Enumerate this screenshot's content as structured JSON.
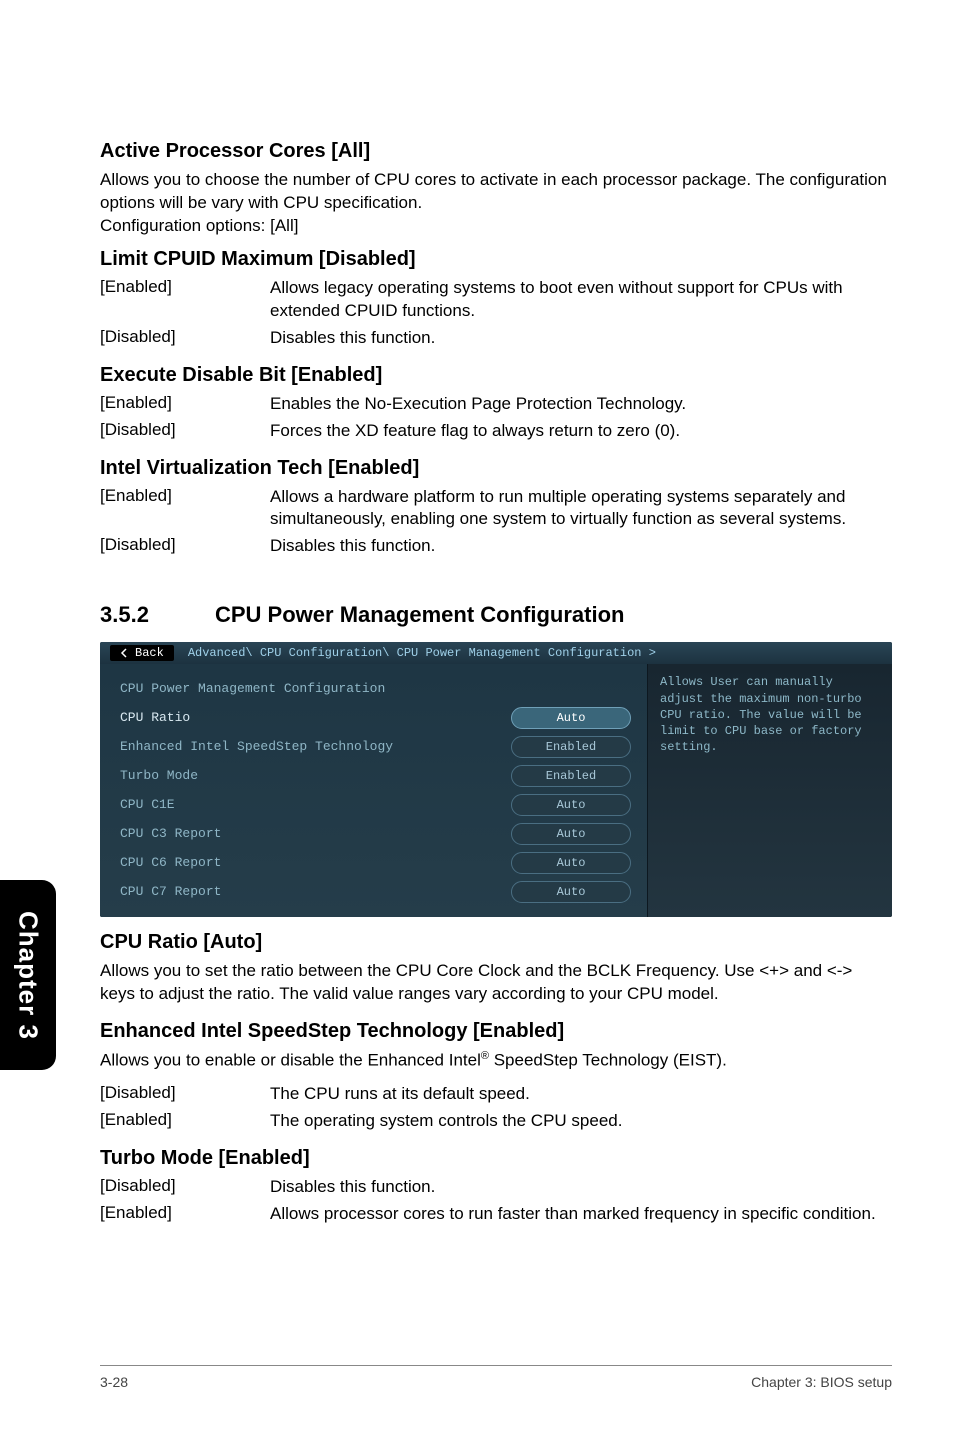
{
  "sidetab": "Chapter 3",
  "sections": {
    "apc": {
      "title": "Active Processor Cores [All]",
      "body": "Allows you to choose the number of CPU cores to activate in each processor package. The configuration options will be vary with CPU specification.",
      "body2": "Configuration options: [All]"
    },
    "lcm": {
      "title": "Limit CPUID Maximum [Disabled]",
      "rows": [
        {
          "k": "[Enabled]",
          "v": "Allows legacy operating systems to boot even without support for CPUs with extended CPUID functions."
        },
        {
          "k": "[Disabled]",
          "v": "Disables this function."
        }
      ]
    },
    "edb": {
      "title": "Execute Disable Bit [Enabled]",
      "rows": [
        {
          "k": "[Enabled]",
          "v": "Enables the No-Execution Page Protection Technology."
        },
        {
          "k": "[Disabled]",
          "v": "Forces the XD feature flag to always return to zero (0)."
        }
      ]
    },
    "ivt": {
      "title": "Intel Virtualization Tech [Enabled]",
      "rows": [
        {
          "k": "[Enabled]",
          "v": "Allows a hardware platform to run multiple operating systems separately and simultaneously, enabling one system to virtually function as several systems."
        },
        {
          "k": "[Disabled]",
          "v": "Disables this function."
        }
      ]
    },
    "cpm": {
      "num": "3.5.2",
      "title": "CPU Power Management Configuration"
    },
    "bios": {
      "back": "Back",
      "breadcrumb": "Advanced\\ CPU Configuration\\ CPU Power Management Configuration >",
      "header": "CPU Power Management Configuration",
      "right": "Allows User can manually adjust the maximum non-turbo CPU ratio. The value will be limit to CPU base or factory setting.",
      "rows": [
        {
          "label": "CPU Ratio",
          "value": "Auto",
          "sel": true
        },
        {
          "label": "Enhanced Intel SpeedStep Technology",
          "value": "Enabled"
        },
        {
          "label": "Turbo Mode",
          "value": "Enabled"
        },
        {
          "label": "CPU C1E",
          "value": "Auto"
        },
        {
          "label": "CPU C3 Report",
          "value": "Auto"
        },
        {
          "label": "CPU C6 Report",
          "value": "Auto"
        },
        {
          "label": "CPU C7 Report",
          "value": "Auto"
        }
      ]
    },
    "cpuratio": {
      "title": "CPU Ratio [Auto]",
      "body": "Allows you to set the ratio between the CPU Core Clock and the BCLK Frequency. Use <+> and <-> keys to adjust the ratio. The valid value ranges vary according to your CPU model."
    },
    "eist": {
      "title": "Enhanced Intel SpeedStep Technology [Enabled]",
      "body_pre": "Allows you to enable or disable the Enhanced Intel",
      "body_post": " SpeedStep Technology (EIST).",
      "rows": [
        {
          "k": "[Disabled]",
          "v": "The CPU runs at its default speed."
        },
        {
          "k": "[Enabled]",
          "v": "The operating system controls the CPU speed."
        }
      ]
    },
    "turbo": {
      "title": "Turbo Mode [Enabled]",
      "rows": [
        {
          "k": "[Disabled]",
          "v": "Disables this function."
        },
        {
          "k": "[Enabled]",
          "v": "Allows processor cores to run faster than marked frequency in specific condition."
        }
      ]
    }
  },
  "footer": {
    "left": "3-28",
    "right": "Chapter 3: BIOS setup"
  }
}
